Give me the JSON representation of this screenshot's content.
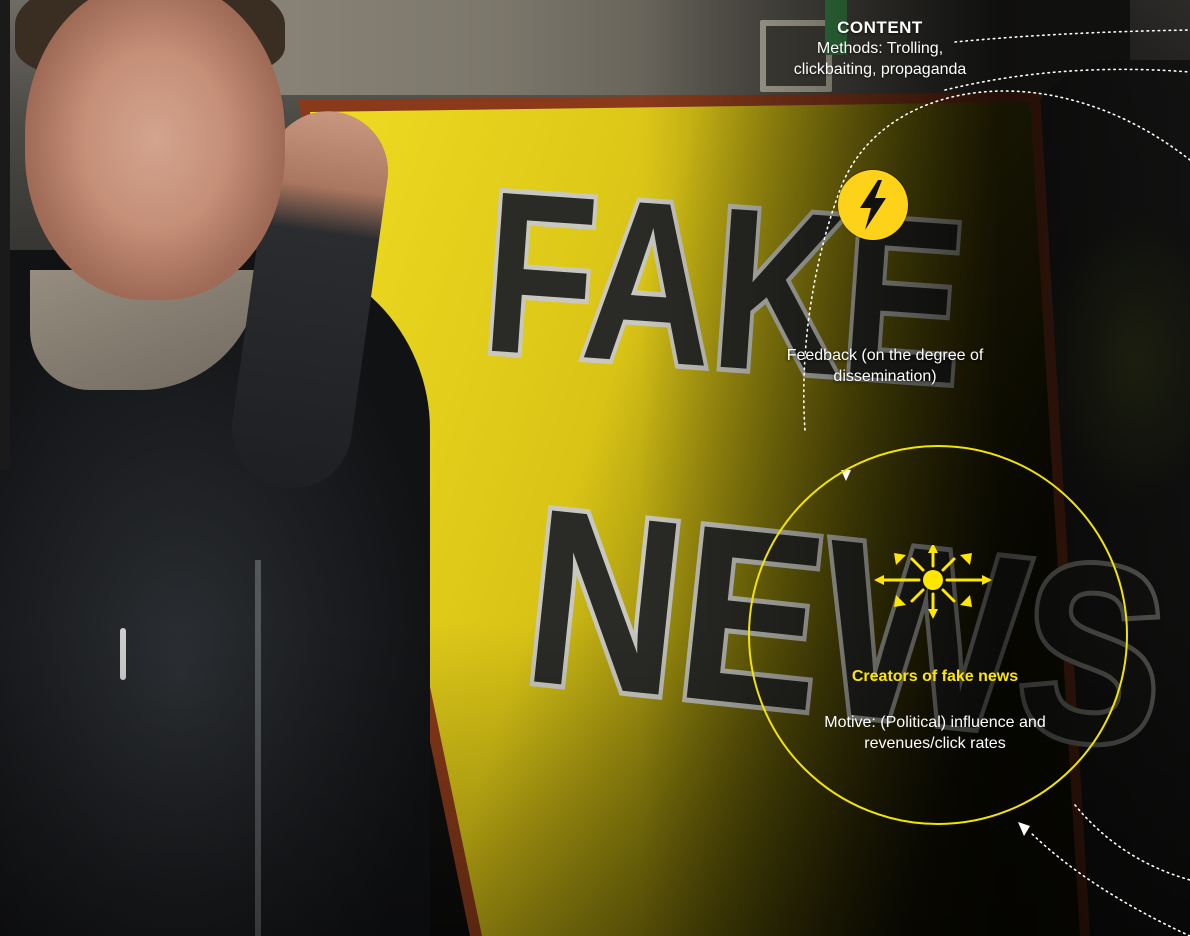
{
  "content_block": {
    "heading": "CONTENT",
    "methods": "Methods: Trolling, clickbaiting, propaganda"
  },
  "feedback": {
    "label": "Feedback (on the degree of dissemination)"
  },
  "creators": {
    "title": "Creators of fake news",
    "motive": "Motive: (Political) influence and revenues/click rates"
  },
  "sign": {
    "line1": "FAKE",
    "line2": "NEWS"
  },
  "icons": {
    "content_icon": "lightning-icon",
    "creators_icon": "broadcast-burst-icon"
  },
  "colors": {
    "accent_yellow": "#ffe600",
    "sign_yellow": "#e6cf10",
    "badge_yellow": "#ffd21a",
    "text": "#ffffff"
  }
}
